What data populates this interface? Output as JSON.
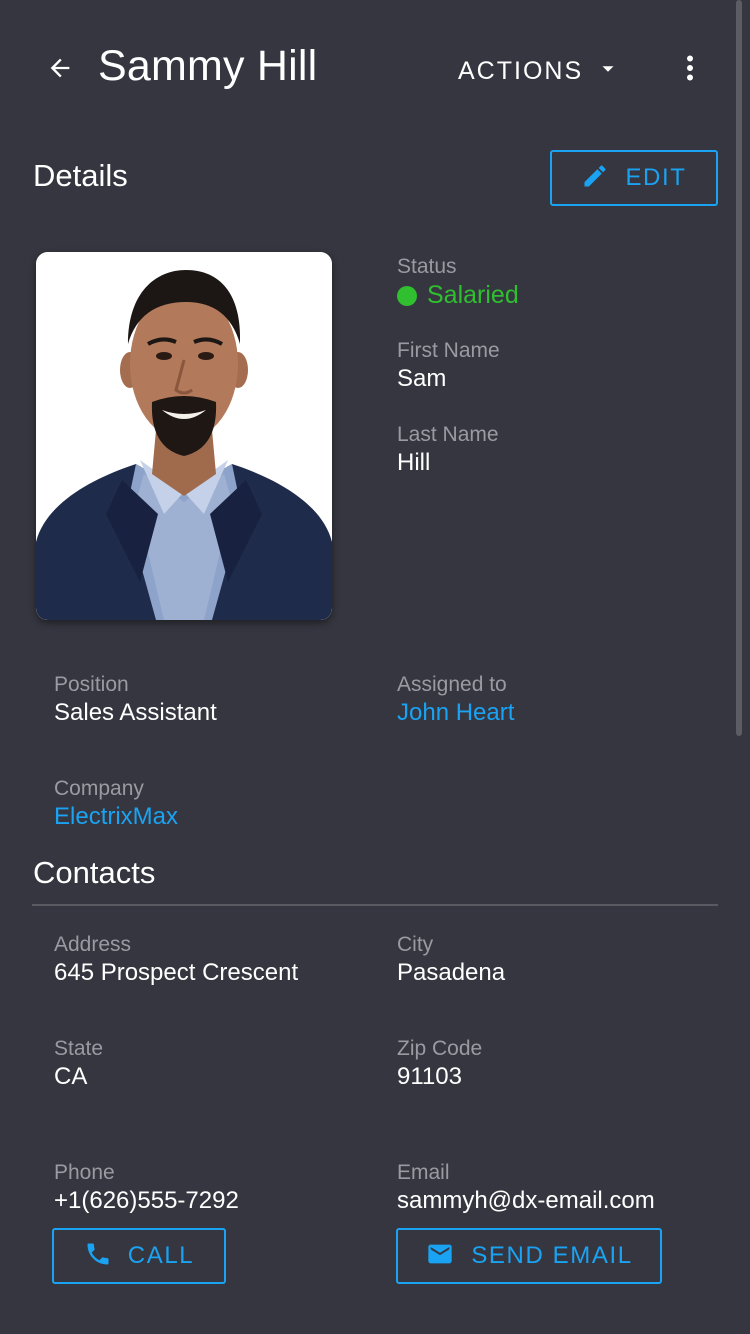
{
  "header": {
    "title": "Sammy Hill",
    "actions_label": "ACTIONS"
  },
  "details": {
    "title": "Details",
    "edit_label": "EDIT",
    "status": {
      "label": "Status",
      "value": "Salaried",
      "color": "#2fbf2f"
    },
    "first_name": {
      "label": "First Name",
      "value": "Sam"
    },
    "last_name": {
      "label": "Last Name",
      "value": "Hill"
    },
    "position": {
      "label": "Position",
      "value": "Sales Assistant"
    },
    "assigned_to": {
      "label": "Assigned to",
      "value": "John Heart"
    },
    "company": {
      "label": "Company",
      "value": "ElectrixMax"
    }
  },
  "contacts": {
    "title": "Contacts",
    "address": {
      "label": "Address",
      "value": "645 Prospect Crescent"
    },
    "city": {
      "label": "City",
      "value": "Pasadena"
    },
    "state": {
      "label": "State",
      "value": "CA"
    },
    "zip": {
      "label": "Zip Code",
      "value": "91103"
    },
    "phone": {
      "label": "Phone",
      "value": "+1(626)555-7292"
    },
    "email": {
      "label": "Email",
      "value": "sammyh@dx-email.com"
    },
    "call_label": "CALL",
    "send_email_label": "SEND EMAIL"
  },
  "icons": {
    "back": "arrow-left-icon",
    "dropdown": "caret-down-icon",
    "more": "more-vertical-icon",
    "edit": "pencil-icon",
    "call": "phone-icon",
    "email": "envelope-icon"
  },
  "colors": {
    "background": "#363640",
    "accent": "#1aa3f2",
    "status_green": "#2fbf2f",
    "label_gray": "#9a9aa2"
  }
}
